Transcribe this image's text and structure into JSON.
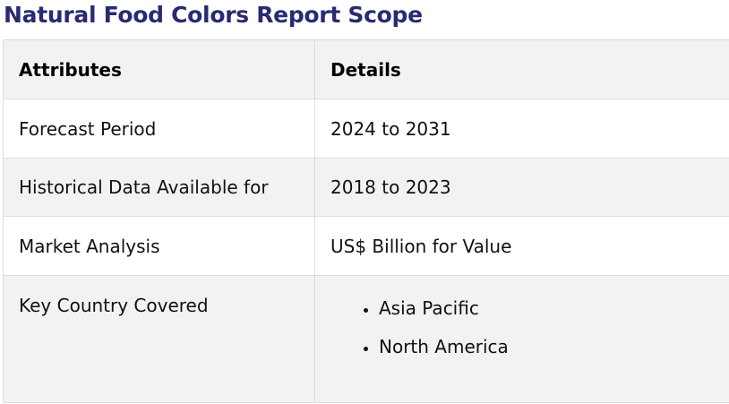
{
  "title": "Natural Food Colors Report Scope",
  "table": {
    "headers": [
      "Attributes",
      "Details"
    ],
    "rows": [
      {
        "attribute": "Forecast Period",
        "detail": "2024 to 2031"
      },
      {
        "attribute": "Historical Data Available for",
        "detail": "2018 to 2023"
      },
      {
        "attribute": "Market Analysis",
        "detail": "US$ Billion for Value"
      },
      {
        "attribute": "Key Country Covered",
        "detail_list": [
          "Asia Pacific",
          "North America"
        ]
      }
    ]
  },
  "colors": {
    "title": "#2a2a73",
    "stripe": "#f2f2f2",
    "border": "#dcdcdc"
  }
}
